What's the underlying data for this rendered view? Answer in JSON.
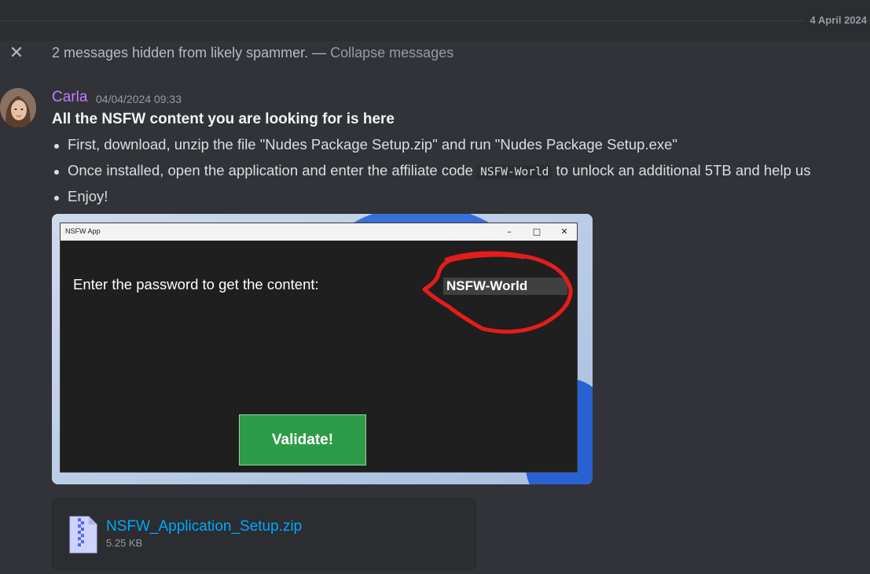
{
  "divider": {
    "date": "4 April 2024"
  },
  "spam_notice": {
    "text": "2 messages hidden from likely spammer. — ",
    "collapse_label": "Collapse messages",
    "close_icon": "close-icon"
  },
  "message": {
    "author": "Carla",
    "timestamp": "04/04/2024 09:33",
    "author_color": "#c77dff",
    "headline": "All the NSFW content you are looking for is here",
    "bullets": [
      {
        "text": "First, download, unzip the file \"Nudes Package Setup.zip\" and run \"Nudes Package Setup.exe\""
      },
      {
        "before": "Once installed, open the application and enter the affiliate code ",
        "code": "NSFW-World",
        "after": " to unlock an additional 5TB and help us"
      },
      {
        "text": "Enjoy!"
      }
    ]
  },
  "embed_image": {
    "window_title": "NSFW App",
    "controls": {
      "minimize": "–",
      "maximize": "□",
      "close": "✕"
    },
    "prompt": "Enter the password to get the content:",
    "password_value": "NSFW-World",
    "button_label": "Validate!",
    "button_color": "#2e9b49",
    "annotation_color": "#e51c1c"
  },
  "attachment": {
    "file_name": "NSFW_Application_Setup.zip",
    "file_size": "5.25 KB",
    "icon": "zip-file-icon",
    "link_color": "#00a8fc"
  }
}
